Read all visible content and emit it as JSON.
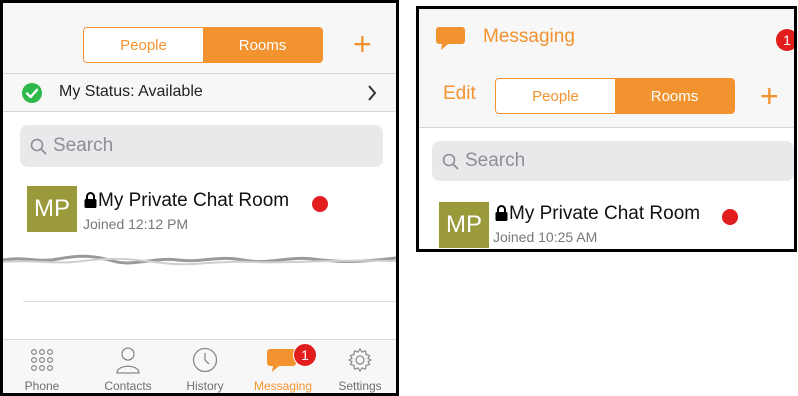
{
  "colors": {
    "accent": "#f29330",
    "badge": "#e21d1d",
    "avatar": "#9b9a3a"
  },
  "left": {
    "segment": {
      "people": "People",
      "rooms": "Rooms"
    },
    "add_icon": "plus-icon",
    "status": {
      "label": "My Status: Available",
      "icon": "check-circle-icon"
    },
    "search": {
      "placeholder": "Search"
    },
    "room": {
      "avatar": "MP",
      "name": "My Private Chat Room",
      "sub": "Joined 12:12 PM"
    },
    "tabs": [
      {
        "label": "Phone",
        "icon": "keypad-icon"
      },
      {
        "label": "Contacts",
        "icon": "person-icon"
      },
      {
        "label": "History",
        "icon": "clock-icon"
      },
      {
        "label": "Messaging",
        "icon": "chat-bubble-icon",
        "badge": "1"
      },
      {
        "label": "Settings",
        "icon": "gear-icon"
      }
    ]
  },
  "right": {
    "title": "Messaging",
    "badge": "1",
    "edit": "Edit",
    "segment": {
      "people": "People",
      "rooms": "Rooms"
    },
    "search": {
      "placeholder": "Search"
    },
    "room": {
      "avatar": "MP",
      "name": "My Private Chat Room",
      "sub": "Joined 10:25 AM"
    }
  }
}
